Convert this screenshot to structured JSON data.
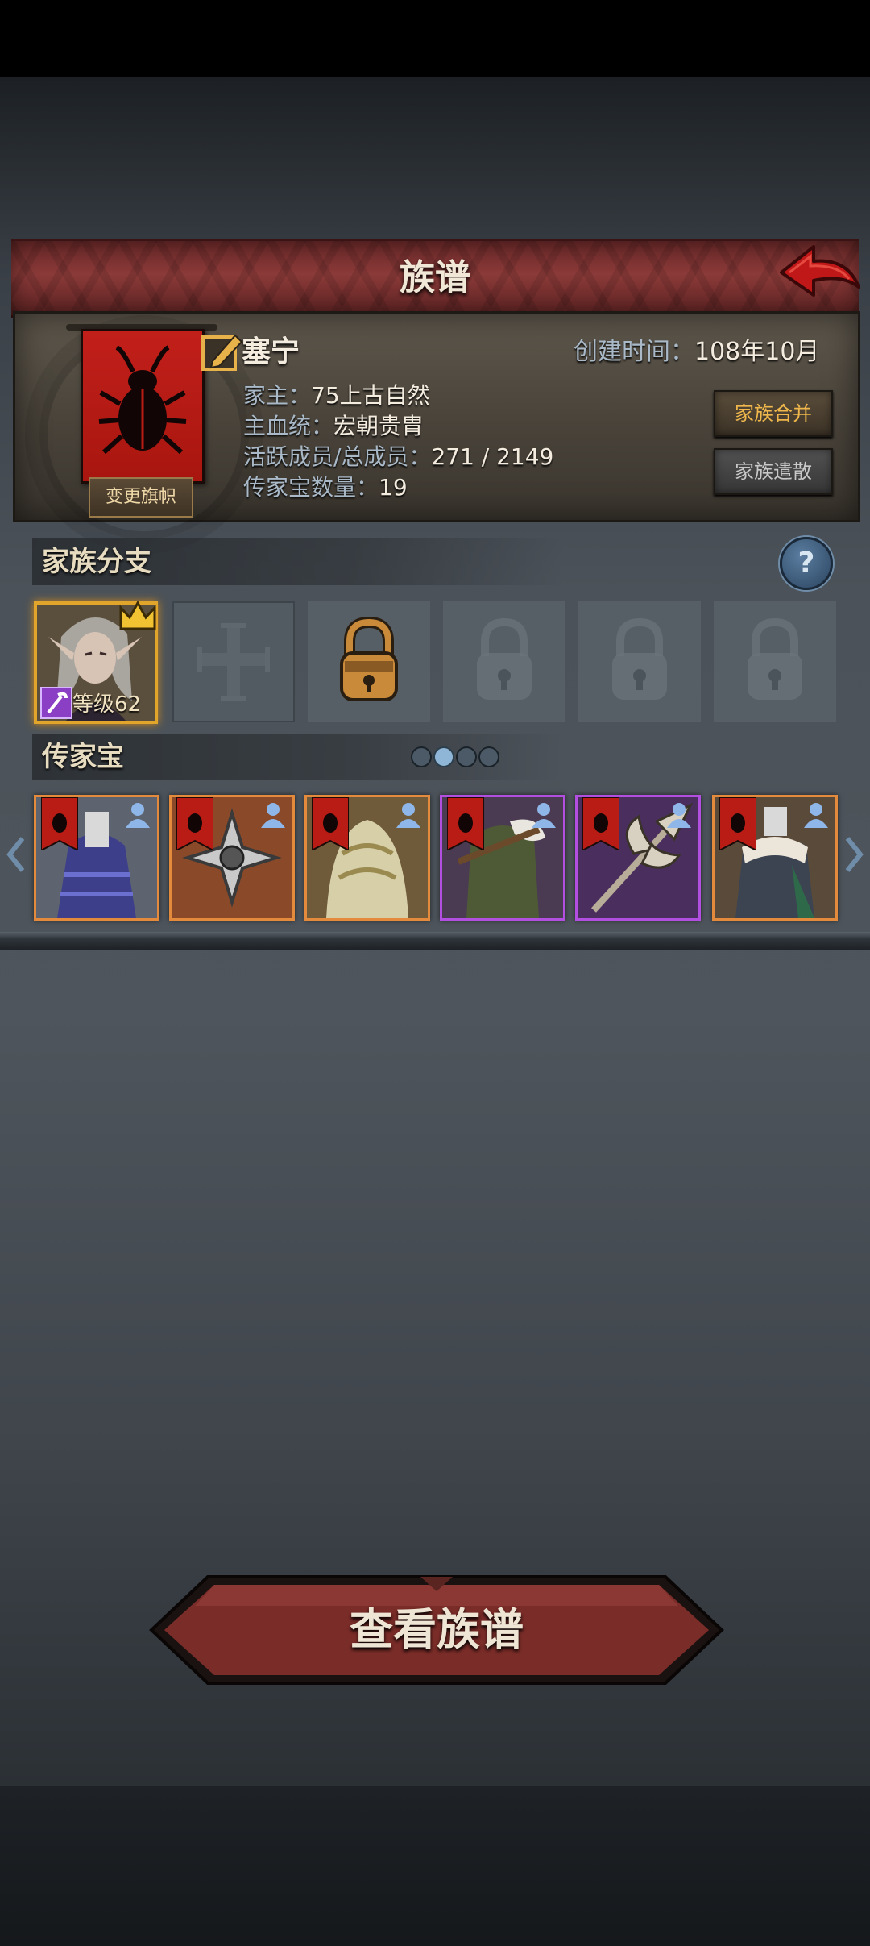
{
  "header": {
    "title": "族谱",
    "back_icon": "back-arrow-icon"
  },
  "clan": {
    "name": "塞宁",
    "created_label": "创建时间：",
    "created_value": "108年10月",
    "leader_label": "家主：",
    "leader_value": "75上古自然",
    "bloodline_label": "主血统：",
    "bloodline_value": "宏朝贵胄",
    "members_label": "活跃成员/总成员：",
    "members_value": "271 / 2149",
    "heirloom_count_label": "传家宝数量：",
    "heirloom_count_value": "19",
    "change_banner_label": "变更旗帜",
    "merge_label": "家族合并",
    "disband_label": "家族遣散",
    "banner_color": "#b81c15"
  },
  "branches": {
    "title": "家族分支",
    "help_label": "?",
    "leader_level": "等级62",
    "slots": [
      {
        "state": "hero"
      },
      {
        "state": "empty-cross"
      },
      {
        "state": "unlockable"
      },
      {
        "state": "locked"
      },
      {
        "state": "locked"
      },
      {
        "state": "locked"
      }
    ]
  },
  "heirlooms": {
    "title": "传家宝",
    "page_count": 4,
    "current_page": 2,
    "items": [
      {
        "name": "armor-blue",
        "rarity": "orange",
        "rarity_color": "#e38a3c"
      },
      {
        "name": "shuriken",
        "rarity": "orange",
        "rarity_color": "#e38a3c"
      },
      {
        "name": "armor-gold",
        "rarity": "orange",
        "rarity_color": "#e38a3c"
      },
      {
        "name": "coat-green",
        "rarity": "purple",
        "rarity_color": "#b24fe0"
      },
      {
        "name": "halberd",
        "rarity": "purple",
        "rarity_color": "#b24fe0"
      },
      {
        "name": "coat-fur",
        "rarity": "orange",
        "rarity_color": "#e38a3c"
      }
    ]
  },
  "footer": {
    "view_tree_label": "查看族谱"
  }
}
